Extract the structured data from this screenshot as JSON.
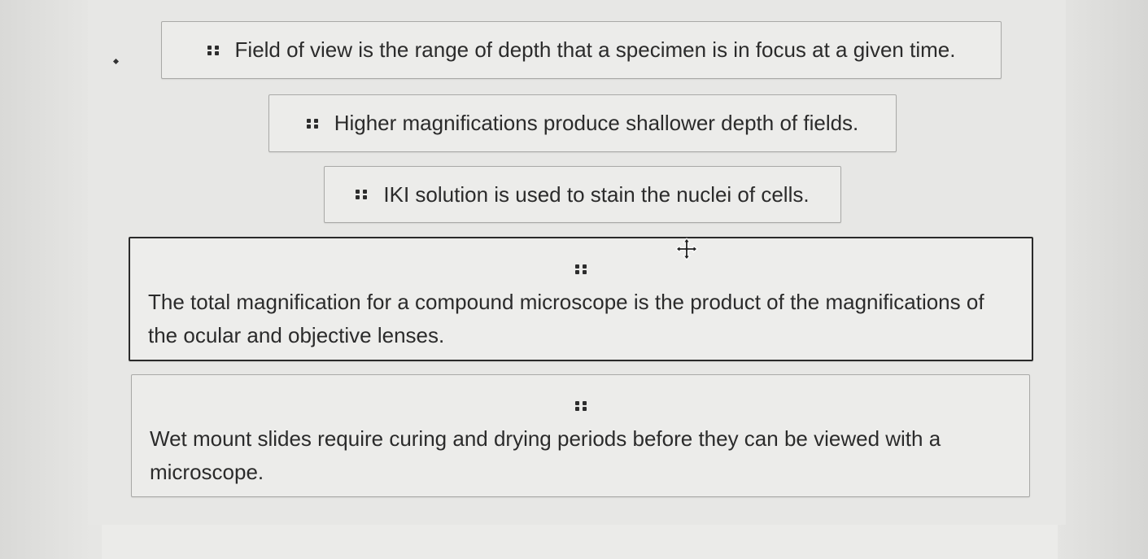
{
  "statements": [
    {
      "text": "Field of view is the range of depth that a specimen is in focus at a given time."
    },
    {
      "text": "Higher magnifications produce shallower depth of fields."
    },
    {
      "text": "IKI solution is used to stain the nuclei of cells."
    },
    {
      "text": "The total magnification for a compound microscope is the product of the magnifications of the ocular and objective lenses."
    },
    {
      "text": "Wet mount slides require curing and drying periods before they can be viewed with a microscope."
    }
  ],
  "icons": {
    "drag_handle": "drag-handle-icon",
    "cursor": "move-cursor-icon"
  }
}
